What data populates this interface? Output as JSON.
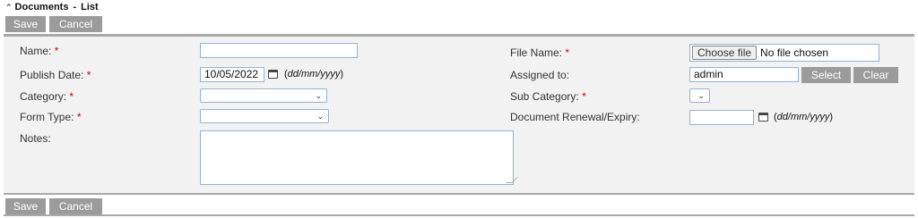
{
  "header": {
    "section": "Documents",
    "separator": "-",
    "page": "List"
  },
  "toolbar_top": {
    "save_label": "Save",
    "cancel_label": "Cancel"
  },
  "toolbar_bottom": {
    "save_label": "Save",
    "cancel_label": "Cancel"
  },
  "form": {
    "name": {
      "label": "Name:",
      "required_marker": "*",
      "value": ""
    },
    "publish_date": {
      "label": "Publish Date:",
      "required_marker": "*",
      "value": "10/05/2022",
      "format_hint": "dd/mm/yyyy"
    },
    "category": {
      "label": "Category:",
      "required_marker": "*",
      "value": ""
    },
    "form_type": {
      "label": "Form Type:",
      "required_marker": "*",
      "value": ""
    },
    "notes": {
      "label": "Notes:",
      "value": ""
    },
    "file_name": {
      "label": "File Name:",
      "required_marker": "*",
      "button_label": "Choose file",
      "status": "No file chosen"
    },
    "assigned_to": {
      "label": "Assigned to:",
      "value": "admin",
      "select_label": "Select",
      "clear_label": "Clear"
    },
    "sub_category": {
      "label": "Sub Category:",
      "required_marker": "*",
      "value": ""
    },
    "renewal_expiry": {
      "label": "Document Renewal/Expiry:",
      "value": "",
      "format_hint": "dd/mm/yyyy"
    }
  },
  "colors": {
    "button_bg": "#9b9b9b",
    "form_bg": "#f2f2f2",
    "required": "#d00000",
    "input_border": "#8fb3d9"
  }
}
